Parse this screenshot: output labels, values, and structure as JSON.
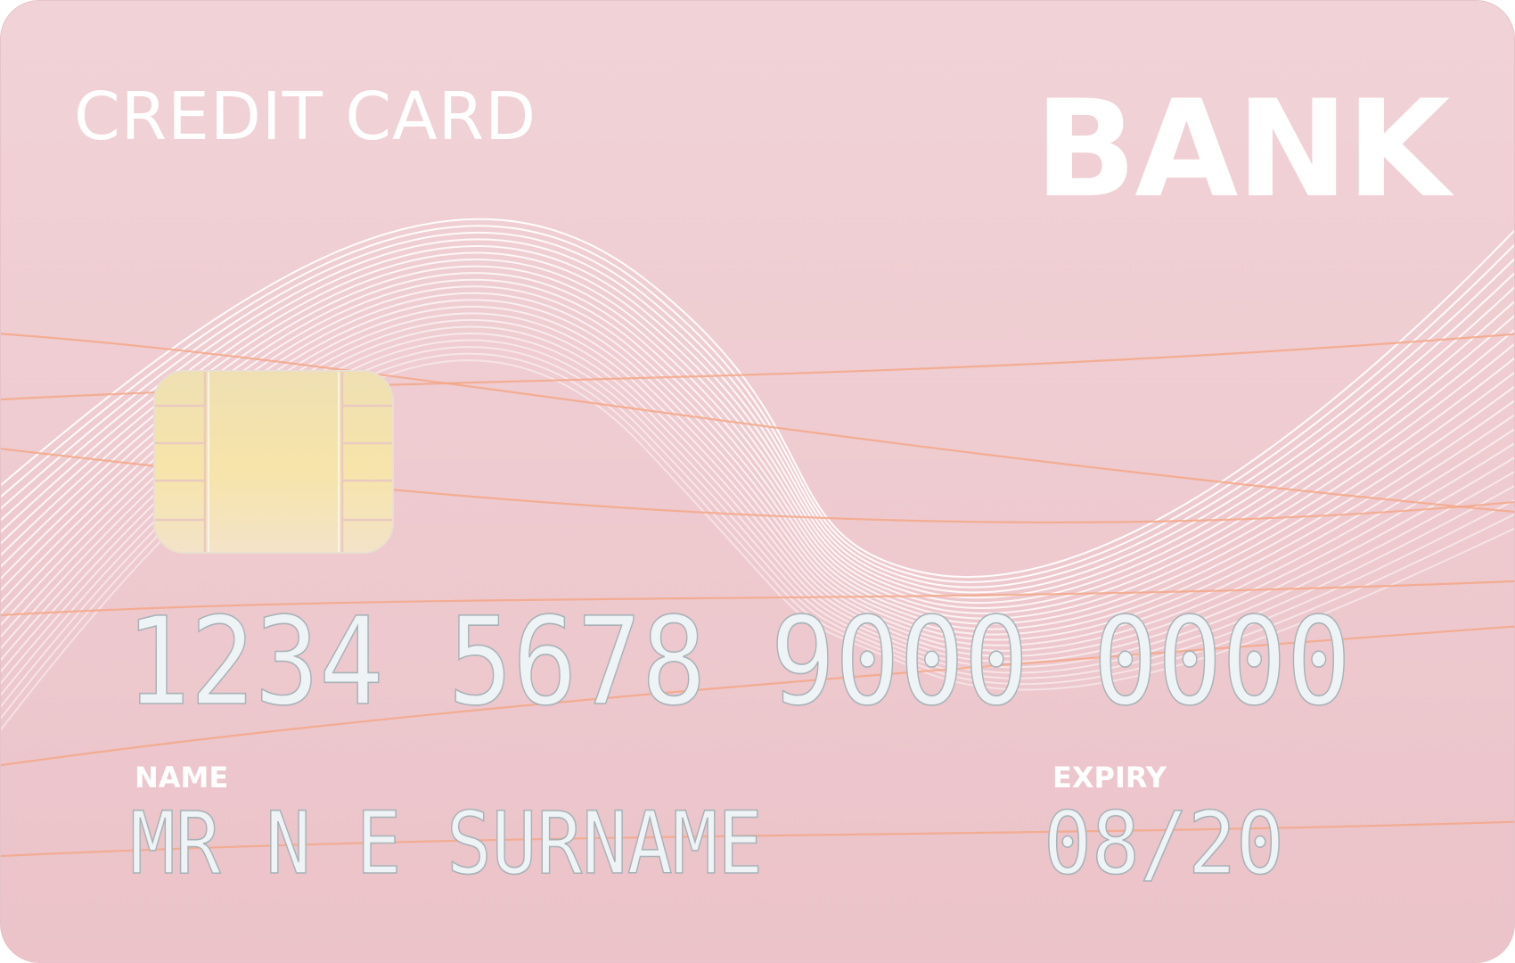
{
  "card": {
    "type_label": "CREDIT CARD",
    "bank_name": "BANK",
    "number": "1234 5678 9000 0000",
    "name_label": "NAME",
    "holder_name": "MR N E SURNAME",
    "expiry_label": "EXPIRY",
    "expiry": "08/20"
  },
  "colors": {
    "background": "#efcbd0",
    "text": "#ffffff",
    "embossed": "#eef3f5",
    "chip": "#f3dfa4",
    "accent_wave": "#f4a583"
  },
  "icons": {
    "chip": "emv-chip-icon"
  }
}
